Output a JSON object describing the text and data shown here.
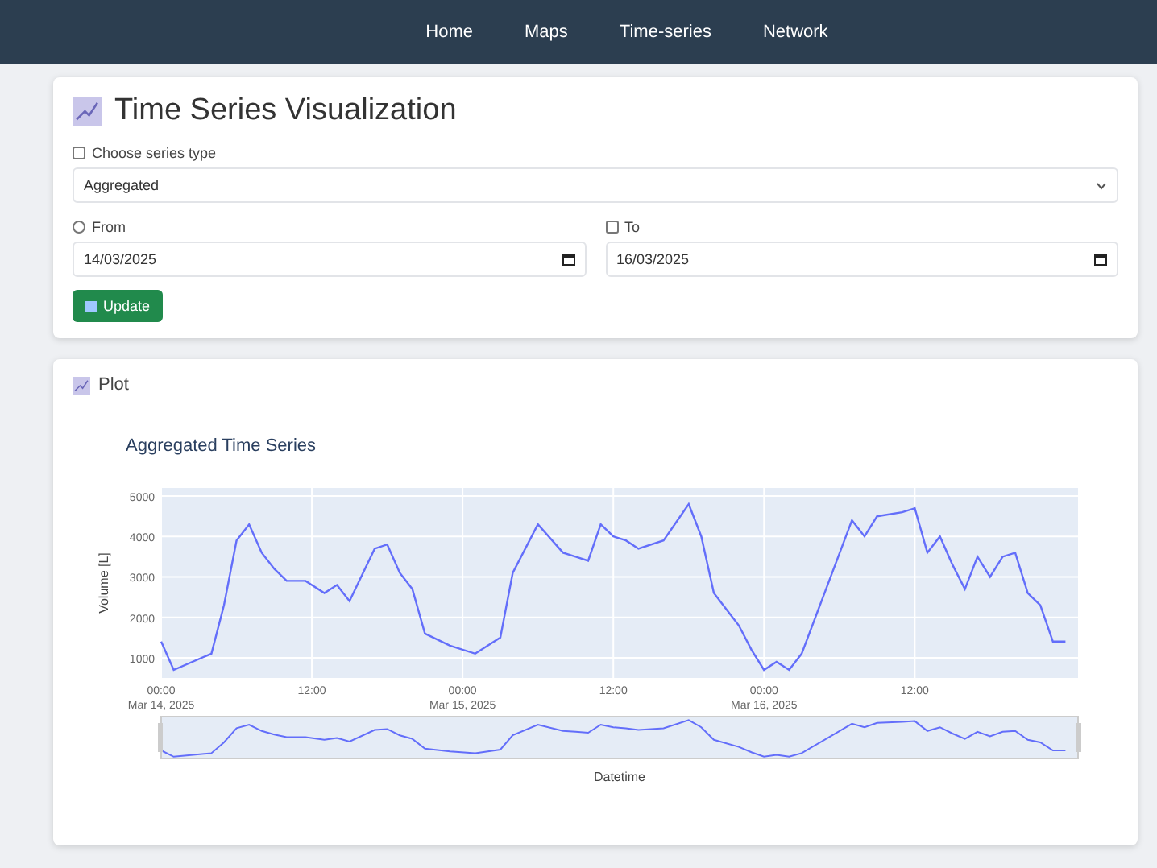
{
  "nav": {
    "items": [
      {
        "label": "Home"
      },
      {
        "label": "Maps"
      },
      {
        "label": "Time-series"
      },
      {
        "label": "Network"
      }
    ]
  },
  "controls": {
    "title": "Time Series Visualization",
    "series_label": "Choose series type",
    "series_value": "Aggregated",
    "from_label": "From",
    "from_value": "14/03/2025",
    "to_label": "To",
    "to_value": "16/03/2025",
    "button": "Update"
  },
  "plot": {
    "heading": "Plot",
    "chart_data": {
      "type": "line",
      "title": "Aggregated Time Series",
      "xlabel": "Datetime",
      "ylabel": "Volume [L]",
      "xlim": [
        "2025-03-14 00:00",
        "2025-03-17 01:00"
      ],
      "ylim": [
        500,
        5200
      ],
      "grid": true,
      "yticks": [
        1000,
        2000,
        3000,
        4000,
        5000
      ],
      "xticks": [
        {
          "value": "2025-03-14 00:00",
          "label": "00:00\nMar 14, 2025"
        },
        {
          "value": "2025-03-14 12:00",
          "label": "12:00"
        },
        {
          "value": "2025-03-15 00:00",
          "label": "00:00\nMar 15, 2025"
        },
        {
          "value": "2025-03-15 12:00",
          "label": "12:00"
        },
        {
          "value": "2025-03-16 00:00",
          "label": "00:00\nMar 16, 2025"
        },
        {
          "value": "2025-03-16 12:00",
          "label": "12:00"
        }
      ],
      "x": [
        "2025-03-14 00:00",
        "2025-03-14 01:00",
        "2025-03-14 04:00",
        "2025-03-14 05:00",
        "2025-03-14 06:00",
        "2025-03-14 07:00",
        "2025-03-14 08:00",
        "2025-03-14 09:00",
        "2025-03-14 10:00",
        "2025-03-14 11:30",
        "2025-03-14 13:00",
        "2025-03-14 14:00",
        "2025-03-14 15:00",
        "2025-03-14 17:00",
        "2025-03-14 18:00",
        "2025-03-14 19:00",
        "2025-03-14 20:00",
        "2025-03-14 21:00",
        "2025-03-14 23:00",
        "2025-03-15 01:00",
        "2025-03-15 03:00",
        "2025-03-15 04:00",
        "2025-03-15 06:00",
        "2025-03-15 08:00",
        "2025-03-15 09:00",
        "2025-03-15 10:00",
        "2025-03-15 11:00",
        "2025-03-15 12:00",
        "2025-03-15 13:00",
        "2025-03-15 14:00",
        "2025-03-15 16:00",
        "2025-03-15 18:00",
        "2025-03-15 19:00",
        "2025-03-15 20:00",
        "2025-03-15 22:00",
        "2025-03-15 23:00",
        "2025-03-16 00:00",
        "2025-03-16 01:00",
        "2025-03-16 02:00",
        "2025-03-16 03:00",
        "2025-03-16 07:00",
        "2025-03-16 08:00",
        "2025-03-16 09:00",
        "2025-03-16 11:00",
        "2025-03-16 12:00",
        "2025-03-16 13:00",
        "2025-03-16 14:00",
        "2025-03-16 15:00",
        "2025-03-16 16:00",
        "2025-03-16 17:00",
        "2025-03-16 18:00",
        "2025-03-16 19:00",
        "2025-03-16 20:00",
        "2025-03-16 21:00",
        "2025-03-16 22:00",
        "2025-03-16 23:00",
        "2025-03-17 00:00"
      ],
      "series": [
        {
          "color": "#636efa",
          "values": [
            1400,
            700,
            1100,
            2300,
            3900,
            4300,
            3600,
            3200,
            2900,
            2900,
            2600,
            2800,
            2400,
            3700,
            3800,
            3100,
            2700,
            1600,
            1300,
            1100,
            1500,
            3100,
            4300,
            3600,
            3500,
            3400,
            4300,
            4000,
            3900,
            3700,
            3900,
            4800,
            4000,
            2600,
            1800,
            1200,
            700,
            900,
            700,
            1100,
            4400,
            4000,
            4500,
            4600,
            4700,
            3600,
            4000,
            3300,
            2700,
            3500,
            3000,
            3500,
            3600,
            2600,
            2300,
            1400,
            1400
          ]
        }
      ]
    }
  }
}
